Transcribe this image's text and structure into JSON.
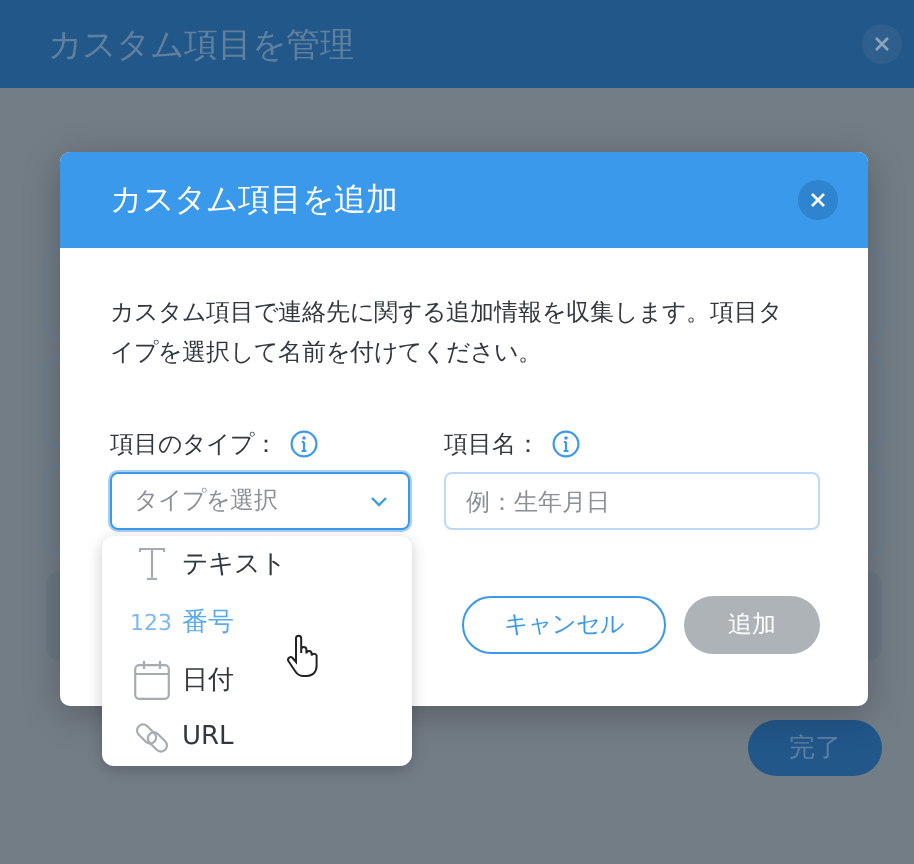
{
  "background_window": {
    "title": "カスタム項目を管理",
    "done_button": "完了"
  },
  "dialog": {
    "title": "カスタム項目を追加",
    "description": "カスタム項目で連絡先に関する追加情報を収集します。項目タイプを選択して名前を付けてください。",
    "type_field": {
      "label": "項目のタイプ：",
      "placeholder": "タイプを選択",
      "focused": true
    },
    "name_field": {
      "label": "項目名：",
      "placeholder": "例：生年月日"
    },
    "type_options": [
      {
        "kind": "text",
        "label": "テキスト",
        "hovered": false
      },
      {
        "kind": "number",
        "icon_text": "123",
        "label": "番号",
        "hovered": true
      },
      {
        "kind": "date",
        "label": "日付",
        "hovered": false
      },
      {
        "kind": "url",
        "label": "URL",
        "hovered": false
      }
    ],
    "buttons": [
      {
        "label": "キャンセル",
        "kind": "secondary",
        "disabled": false
      },
      {
        "label": "追加",
        "kind": "primary",
        "disabled": true
      }
    ]
  }
}
